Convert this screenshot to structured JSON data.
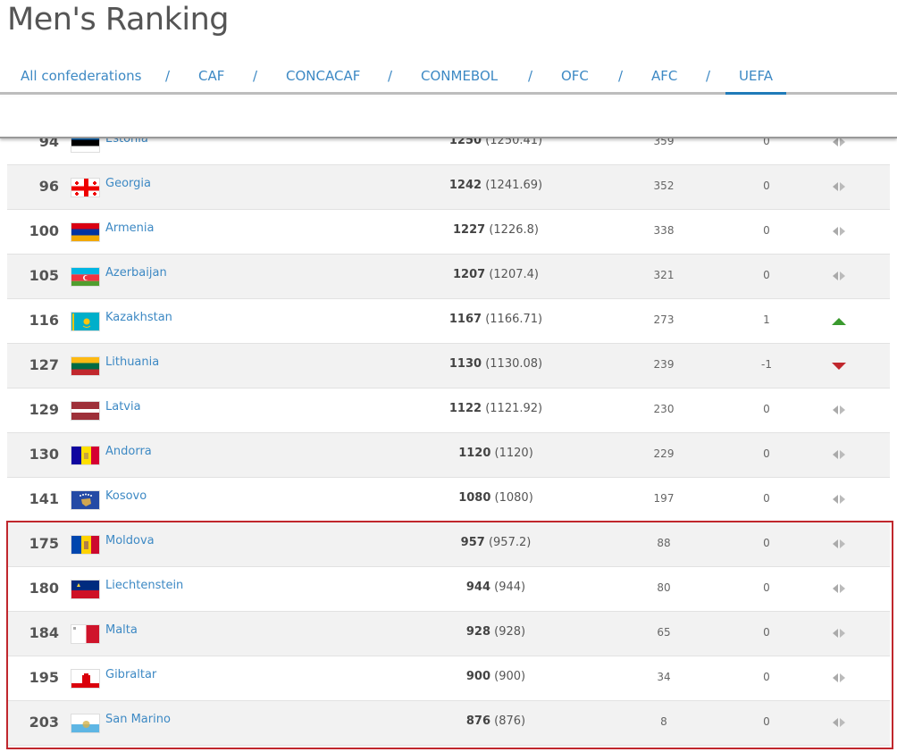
{
  "title": "Men's Ranking",
  "tabs": [
    {
      "label": "All confederations",
      "active": false
    },
    {
      "label": "CAF",
      "active": false
    },
    {
      "label": "CONCACAF",
      "active": false
    },
    {
      "label": "CONMEBOL",
      "active": false
    },
    {
      "label": "OFC",
      "active": false
    },
    {
      "label": "AFC",
      "active": false
    },
    {
      "label": "UEFA",
      "active": true
    }
  ],
  "separator": "/",
  "colors": {
    "link": "#3d89c4",
    "highlight_border": "#c0272d",
    "up": "#3a9a2e",
    "down": "#c0272d",
    "neutral": "#aaaaaa"
  },
  "rows": [
    {
      "rank": "94",
      "team": "Estonia",
      "flag": "estonia",
      "points": "1250",
      "points_exact": "(1250.41)",
      "prev_points": "359",
      "change": "0",
      "trend": "neutral"
    },
    {
      "rank": "96",
      "team": "Georgia",
      "flag": "georgia",
      "points": "1242",
      "points_exact": "(1241.69)",
      "prev_points": "352",
      "change": "0",
      "trend": "neutral"
    },
    {
      "rank": "100",
      "team": "Armenia",
      "flag": "armenia",
      "points": "1227",
      "points_exact": "(1226.8)",
      "prev_points": "338",
      "change": "0",
      "trend": "neutral"
    },
    {
      "rank": "105",
      "team": "Azerbaijan",
      "flag": "azerbaijan",
      "points": "1207",
      "points_exact": "(1207.4)",
      "prev_points": "321",
      "change": "0",
      "trend": "neutral"
    },
    {
      "rank": "116",
      "team": "Kazakhstan",
      "flag": "kazakhstan",
      "points": "1167",
      "points_exact": "(1166.71)",
      "prev_points": "273",
      "change": "1",
      "trend": "up"
    },
    {
      "rank": "127",
      "team": "Lithuania",
      "flag": "lithuania",
      "points": "1130",
      "points_exact": "(1130.08)",
      "prev_points": "239",
      "change": "-1",
      "trend": "down"
    },
    {
      "rank": "129",
      "team": "Latvia",
      "flag": "latvia",
      "points": "1122",
      "points_exact": "(1121.92)",
      "prev_points": "230",
      "change": "0",
      "trend": "neutral"
    },
    {
      "rank": "130",
      "team": "Andorra",
      "flag": "andorra",
      "points": "1120",
      "points_exact": "(1120)",
      "prev_points": "229",
      "change": "0",
      "trend": "neutral"
    },
    {
      "rank": "141",
      "team": "Kosovo",
      "flag": "kosovo",
      "points": "1080",
      "points_exact": "(1080)",
      "prev_points": "197",
      "change": "0",
      "trend": "neutral"
    },
    {
      "rank": "175",
      "team": "Moldova",
      "flag": "moldova",
      "points": "957",
      "points_exact": "(957.2)",
      "prev_points": "88",
      "change": "0",
      "trend": "neutral"
    },
    {
      "rank": "180",
      "team": "Liechtenstein",
      "flag": "liechtenstein",
      "points": "944",
      "points_exact": "(944)",
      "prev_points": "80",
      "change": "0",
      "trend": "neutral"
    },
    {
      "rank": "184",
      "team": "Malta",
      "flag": "malta",
      "points": "928",
      "points_exact": "(928)",
      "prev_points": "65",
      "change": "0",
      "trend": "neutral"
    },
    {
      "rank": "195",
      "team": "Gibraltar",
      "flag": "gibraltar",
      "points": "900",
      "points_exact": "(900)",
      "prev_points": "34",
      "change": "0",
      "trend": "neutral"
    },
    {
      "rank": "203",
      "team": "San Marino",
      "flag": "san-marino",
      "points": "876",
      "points_exact": "(876)",
      "prev_points": "8",
      "change": "0",
      "trend": "neutral"
    }
  ]
}
